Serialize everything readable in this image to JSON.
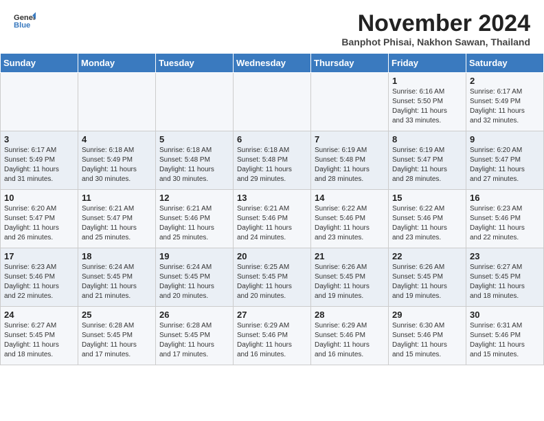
{
  "header": {
    "logo_line1": "General",
    "logo_line2": "Blue",
    "month": "November 2024",
    "location": "Banphot Phisai, Nakhon Sawan, Thailand"
  },
  "days_of_week": [
    "Sunday",
    "Monday",
    "Tuesday",
    "Wednesday",
    "Thursday",
    "Friday",
    "Saturday"
  ],
  "weeks": [
    [
      {
        "day": "",
        "info": ""
      },
      {
        "day": "",
        "info": ""
      },
      {
        "day": "",
        "info": ""
      },
      {
        "day": "",
        "info": ""
      },
      {
        "day": "",
        "info": ""
      },
      {
        "day": "1",
        "info": "Sunrise: 6:16 AM\nSunset: 5:50 PM\nDaylight: 11 hours\nand 33 minutes."
      },
      {
        "day": "2",
        "info": "Sunrise: 6:17 AM\nSunset: 5:49 PM\nDaylight: 11 hours\nand 32 minutes."
      }
    ],
    [
      {
        "day": "3",
        "info": "Sunrise: 6:17 AM\nSunset: 5:49 PM\nDaylight: 11 hours\nand 31 minutes."
      },
      {
        "day": "4",
        "info": "Sunrise: 6:18 AM\nSunset: 5:49 PM\nDaylight: 11 hours\nand 30 minutes."
      },
      {
        "day": "5",
        "info": "Sunrise: 6:18 AM\nSunset: 5:48 PM\nDaylight: 11 hours\nand 30 minutes."
      },
      {
        "day": "6",
        "info": "Sunrise: 6:18 AM\nSunset: 5:48 PM\nDaylight: 11 hours\nand 29 minutes."
      },
      {
        "day": "7",
        "info": "Sunrise: 6:19 AM\nSunset: 5:48 PM\nDaylight: 11 hours\nand 28 minutes."
      },
      {
        "day": "8",
        "info": "Sunrise: 6:19 AM\nSunset: 5:47 PM\nDaylight: 11 hours\nand 28 minutes."
      },
      {
        "day": "9",
        "info": "Sunrise: 6:20 AM\nSunset: 5:47 PM\nDaylight: 11 hours\nand 27 minutes."
      }
    ],
    [
      {
        "day": "10",
        "info": "Sunrise: 6:20 AM\nSunset: 5:47 PM\nDaylight: 11 hours\nand 26 minutes."
      },
      {
        "day": "11",
        "info": "Sunrise: 6:21 AM\nSunset: 5:47 PM\nDaylight: 11 hours\nand 25 minutes."
      },
      {
        "day": "12",
        "info": "Sunrise: 6:21 AM\nSunset: 5:46 PM\nDaylight: 11 hours\nand 25 minutes."
      },
      {
        "day": "13",
        "info": "Sunrise: 6:21 AM\nSunset: 5:46 PM\nDaylight: 11 hours\nand 24 minutes."
      },
      {
        "day": "14",
        "info": "Sunrise: 6:22 AM\nSunset: 5:46 PM\nDaylight: 11 hours\nand 23 minutes."
      },
      {
        "day": "15",
        "info": "Sunrise: 6:22 AM\nSunset: 5:46 PM\nDaylight: 11 hours\nand 23 minutes."
      },
      {
        "day": "16",
        "info": "Sunrise: 6:23 AM\nSunset: 5:46 PM\nDaylight: 11 hours\nand 22 minutes."
      }
    ],
    [
      {
        "day": "17",
        "info": "Sunrise: 6:23 AM\nSunset: 5:46 PM\nDaylight: 11 hours\nand 22 minutes."
      },
      {
        "day": "18",
        "info": "Sunrise: 6:24 AM\nSunset: 5:45 PM\nDaylight: 11 hours\nand 21 minutes."
      },
      {
        "day": "19",
        "info": "Sunrise: 6:24 AM\nSunset: 5:45 PM\nDaylight: 11 hours\nand 20 minutes."
      },
      {
        "day": "20",
        "info": "Sunrise: 6:25 AM\nSunset: 5:45 PM\nDaylight: 11 hours\nand 20 minutes."
      },
      {
        "day": "21",
        "info": "Sunrise: 6:26 AM\nSunset: 5:45 PM\nDaylight: 11 hours\nand 19 minutes."
      },
      {
        "day": "22",
        "info": "Sunrise: 6:26 AM\nSunset: 5:45 PM\nDaylight: 11 hours\nand 19 minutes."
      },
      {
        "day": "23",
        "info": "Sunrise: 6:27 AM\nSunset: 5:45 PM\nDaylight: 11 hours\nand 18 minutes."
      }
    ],
    [
      {
        "day": "24",
        "info": "Sunrise: 6:27 AM\nSunset: 5:45 PM\nDaylight: 11 hours\nand 18 minutes."
      },
      {
        "day": "25",
        "info": "Sunrise: 6:28 AM\nSunset: 5:45 PM\nDaylight: 11 hours\nand 17 minutes."
      },
      {
        "day": "26",
        "info": "Sunrise: 6:28 AM\nSunset: 5:45 PM\nDaylight: 11 hours\nand 17 minutes."
      },
      {
        "day": "27",
        "info": "Sunrise: 6:29 AM\nSunset: 5:46 PM\nDaylight: 11 hours\nand 16 minutes."
      },
      {
        "day": "28",
        "info": "Sunrise: 6:29 AM\nSunset: 5:46 PM\nDaylight: 11 hours\nand 16 minutes."
      },
      {
        "day": "29",
        "info": "Sunrise: 6:30 AM\nSunset: 5:46 PM\nDaylight: 11 hours\nand 15 minutes."
      },
      {
        "day": "30",
        "info": "Sunrise: 6:31 AM\nSunset: 5:46 PM\nDaylight: 11 hours\nand 15 minutes."
      }
    ]
  ]
}
